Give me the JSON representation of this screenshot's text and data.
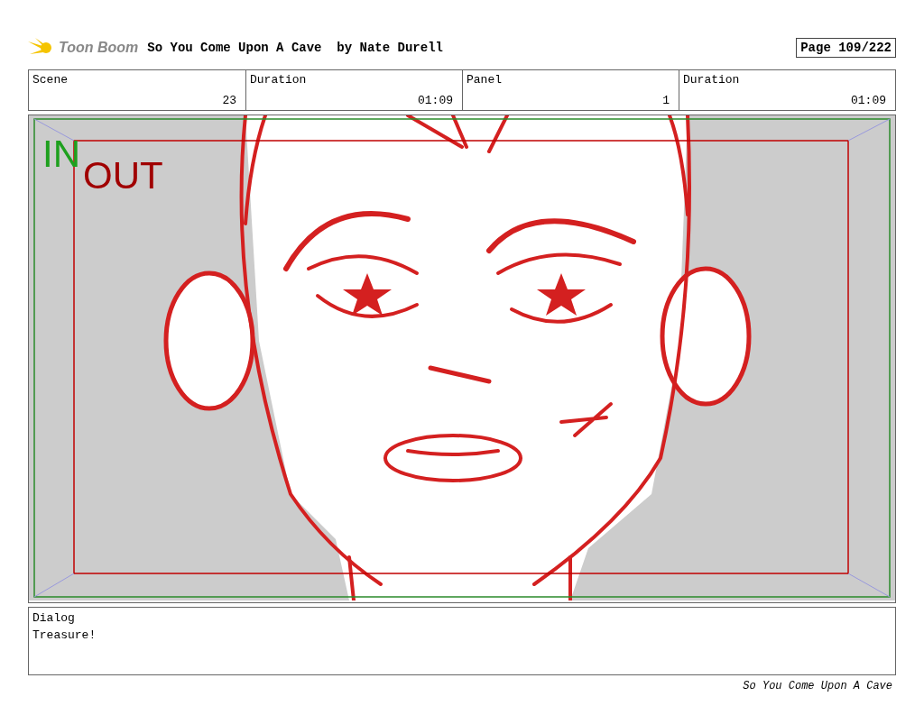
{
  "header": {
    "logo": "Toon Boom",
    "title": "So You Come Upon A Cave  by Nate Durell",
    "page": "Page 109/222"
  },
  "info": [
    {
      "label": "Scene",
      "value": "23"
    },
    {
      "label": "Duration",
      "value": "01:09"
    },
    {
      "label": "Panel",
      "value": "1"
    },
    {
      "label": "Duration",
      "value": "01:09"
    }
  ],
  "panel": {
    "in_label": "IN",
    "out_label": "OUT"
  },
  "dialog": {
    "label": "Dialog",
    "text": "Treasure!"
  },
  "footer": "So You Come Upon A Cave"
}
